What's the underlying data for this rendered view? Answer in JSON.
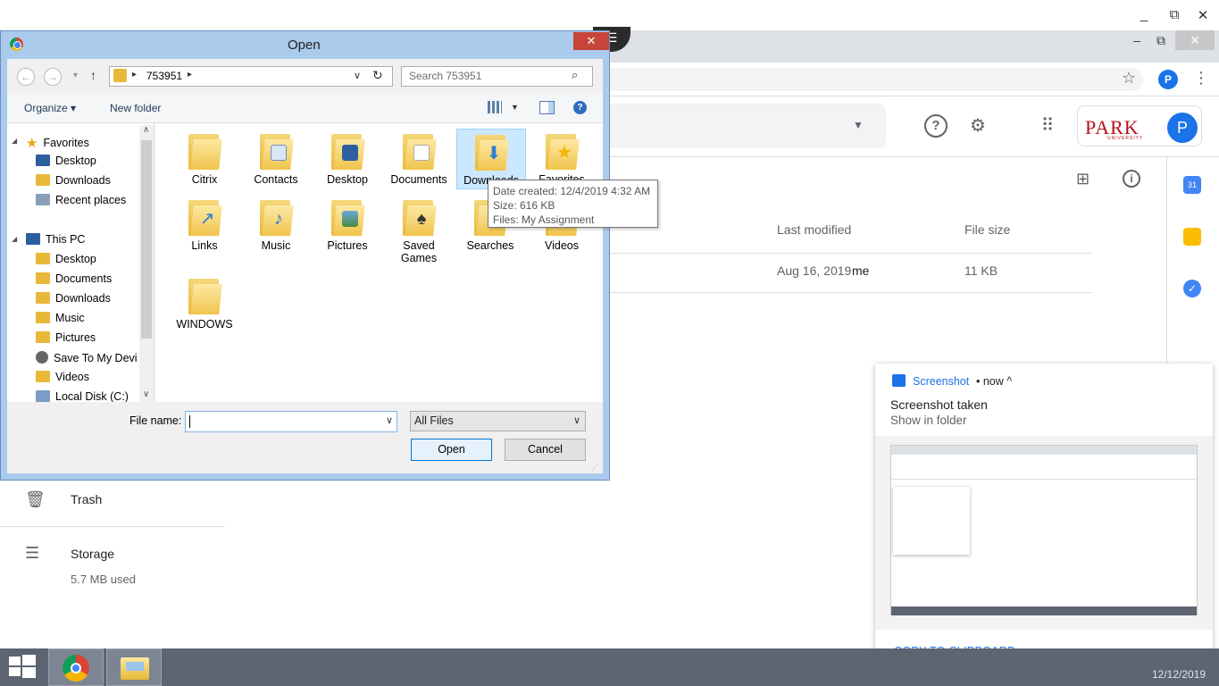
{
  "dialog": {
    "title": "Open",
    "close_glyph": "✕",
    "path_folder": "753951",
    "search_placeholder": "Search 753951",
    "organize_label": "Organize ▾",
    "new_folder_label": "New folder",
    "tree": {
      "favorites": "Favorites",
      "fav_items": [
        "Desktop",
        "Downloads",
        "Recent places"
      ],
      "this_pc": "This PC",
      "pc_items": [
        "Desktop",
        "Documents",
        "Downloads",
        "Music",
        "Pictures",
        "Save To My Devi",
        "Videos",
        "Local Disk (C:)"
      ]
    },
    "folders": [
      "Citrix",
      "Contacts",
      "Desktop",
      "Documents",
      "Downloads",
      "Favorites",
      "Links",
      "Music",
      "Pictures",
      "Saved Games",
      "Searches",
      "Videos",
      "WINDOWS"
    ],
    "tooltip": {
      "date": "Date created: 12/4/2019 4:32 AM",
      "size": "Size: 616 KB",
      "files": "Files: My Assignment"
    },
    "file_name_label": "File name:",
    "file_name_value": "",
    "file_type": "All Files",
    "open_button": "Open",
    "cancel_button": "Cancel"
  },
  "drive": {
    "columns": {
      "modified": "Last modified",
      "size": "File size"
    },
    "row": {
      "modified": "Aug 16, 2019",
      "owner": "me",
      "size": "11 KB"
    },
    "nav": {
      "trash": "Trash",
      "storage": "Storage",
      "storage_used": "5.7 MB used"
    },
    "profile_initial": "P",
    "logo_text": "PARK",
    "logo_sub": "UNIVERSITY"
  },
  "notification": {
    "app": "Screenshot",
    "time": "• now ^",
    "title": "Screenshot taken",
    "message": "Show in folder",
    "action": "COPY TO CLIPBOARD"
  },
  "taskbar": {
    "clock": "12/12/2019"
  },
  "colors": {
    "accent": "#1a73e8",
    "dialog_frame": "#aacbec",
    "close_red": "#c7453a",
    "park_red": "#b5121b"
  }
}
